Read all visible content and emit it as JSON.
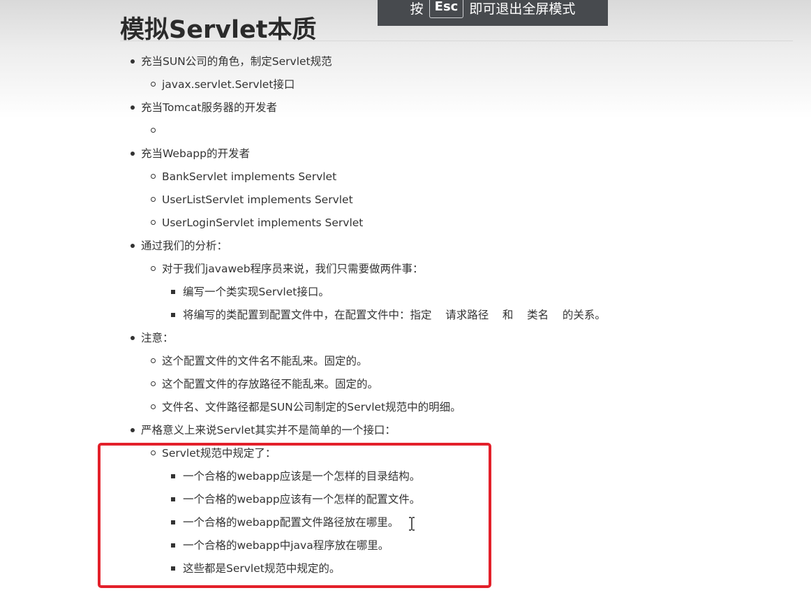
{
  "page": {
    "title": "模拟Servlet本质"
  },
  "fullscreen_banner": {
    "press": "按",
    "key": "Esc",
    "rest": "即可退出全屏模式"
  },
  "outline": {
    "l1": "充当SUN公司的角色，制定Servlet规范",
    "l2": "javax.servlet.Servlet接口",
    "l3": "充当Tomcat服务器的开发者",
    "l4": "",
    "l5": "充当Webapp的开发者",
    "l6": "BankServlet implements Servlet",
    "l7": "UserListServlet implements Servlet",
    "l8": "UserLoginServlet implements Servlet",
    "l9": "通过我们的分析：",
    "l10": "对于我们javaweb程序员来说，我们只需要做两件事：",
    "l11": "编写一个类实现Servlet接口。",
    "l12": "将编写的类配置到配置文件中，在配置文件中：指定    请求路径    和    类名    的关系。",
    "l13": "注意：",
    "l14": "这个配置文件的文件名不能乱来。固定的。",
    "l15": "这个配置文件的存放路径不能乱来。固定的。",
    "l16": "文件名、文件路径都是SUN公司制定的Servlet规范中的明细。",
    "l17": "严格意义上来说Servlet其实并不是简单的一个接口：",
    "l18": "Servlet规范中规定了：",
    "l19": "一个合格的webapp应该是一个怎样的目录结构。",
    "l20": "一个合格的webapp应该有一个怎样的配置文件。",
    "l21": "一个合格的webapp配置文件路径放在哪里。",
    "l22": "一个合格的webapp中java程序放在哪里。",
    "l23": "这些都是Servlet规范中规定的。"
  },
  "colors": {
    "highlight_border": "#e3202a",
    "banner_bg": "#474a4e",
    "text": "#333333"
  },
  "icons": {
    "cursor": "text-cursor-icon"
  }
}
